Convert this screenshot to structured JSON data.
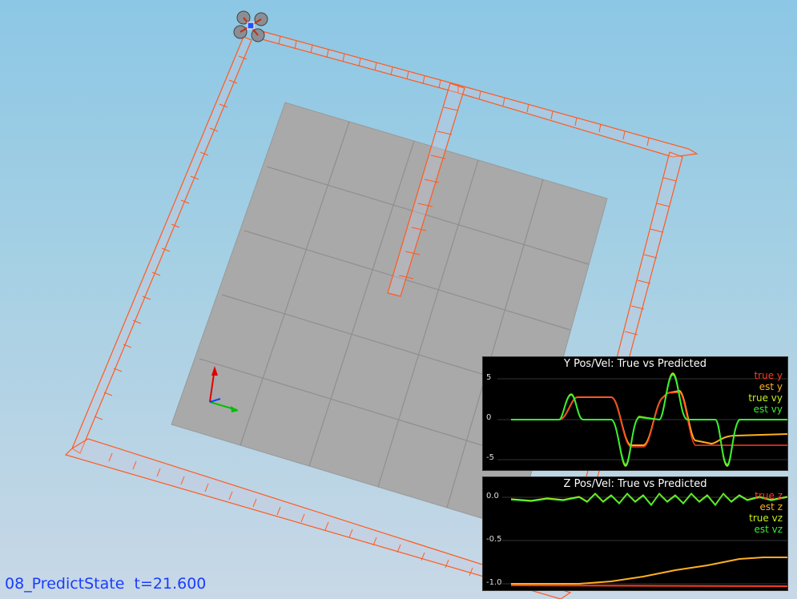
{
  "status": {
    "scenario": "08_PredictState",
    "time": "t=21.600"
  },
  "colors": {
    "trajectory": "#ff5a1e",
    "floor": "#a9a9a9",
    "plot_bg": "#000000",
    "status_text": "#1a3cff"
  },
  "plots": [
    {
      "title": "Y Pos/Vel: True vs Predicted",
      "legend": [
        {
          "label": "true y",
          "color": "#ff3b1f"
        },
        {
          "label": "est y",
          "color": "#ffb020"
        },
        {
          "label": "true vy",
          "color": "#c6f01a"
        },
        {
          "label": "est vy",
          "color": "#38f030"
        }
      ],
      "ticks": [
        "5",
        "0",
        "-5"
      ]
    },
    {
      "title": "Z Pos/Vel: True vs Predicted",
      "legend": [
        {
          "label": "true z",
          "color": "#ff3b1f"
        },
        {
          "label": "est z",
          "color": "#ffb020"
        },
        {
          "label": "true vz",
          "color": "#c6f01a"
        },
        {
          "label": "est vz",
          "color": "#38f030"
        }
      ],
      "ticks": [
        "0.0",
        "-0.5",
        "-1.0"
      ]
    }
  ]
}
